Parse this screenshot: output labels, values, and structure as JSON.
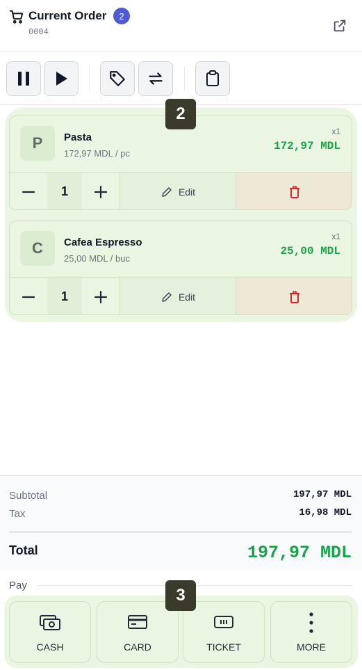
{
  "header": {
    "title": "Current Order",
    "badge_count": "2",
    "order_number": "0004"
  },
  "toolbar": {
    "buttons": [
      "pause-icon",
      "play-icon",
      "tag-icon",
      "swap-icon",
      "clipboard-icon"
    ]
  },
  "cart": {
    "step_badge": "2",
    "items": [
      {
        "initial": "P",
        "name": "Pasta",
        "unit_price": "172,97 MDL / pc",
        "qty_tag": "x1",
        "line_total": "172,97 MDL",
        "quantity": "1",
        "edit_label": "Edit"
      },
      {
        "initial": "C",
        "name": "Cafea Espresso",
        "unit_price": "25,00 MDL / buc",
        "qty_tag": "x1",
        "line_total": "25,00 MDL",
        "quantity": "1",
        "edit_label": "Edit"
      }
    ]
  },
  "totals": {
    "subtotal_label": "Subtotal",
    "subtotal_value": "197,97 MDL",
    "tax_label": "Tax",
    "tax_value": "16,98 MDL",
    "total_label": "Total",
    "total_value": "197,97 MDL"
  },
  "pay": {
    "label": "Pay",
    "step_badge": "3",
    "methods": [
      {
        "label": "CASH",
        "icon": "cash-icon"
      },
      {
        "label": "CARD",
        "icon": "card-icon"
      },
      {
        "label": "TICKET",
        "icon": "ticket-icon"
      },
      {
        "label": "MORE",
        "icon": "more-icon"
      }
    ]
  },
  "colors": {
    "accent_green": "#16a34a",
    "badge_blue": "#4f5bd5",
    "delete_red": "#dc2626",
    "highlight_bg": "#eaf6e1"
  }
}
